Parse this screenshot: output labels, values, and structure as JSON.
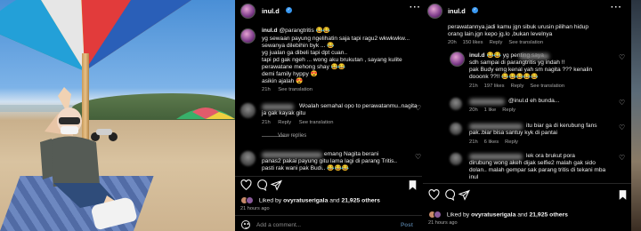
{
  "post": {
    "username": "inul.d",
    "likes_by": "ovyratuserigala",
    "likes_others": "21,925 others",
    "liked_by_prefix": "Liked by",
    "and_word": "and",
    "time_ago": "21 hours ago",
    "add_comment_placeholder": "Add a comment...",
    "post_label": "Post"
  },
  "comments_mid": [
    {
      "user": "inul.d",
      "lines": [
        "@parangtritis 😂😂",
        "yg sewaan payung ngelihatin saja tapi ragu2 wkwkwkw...",
        "sewanya dilebihin byk ... 😂",
        "yg jualan ga dibeli tapi dpt cuan..",
        "tapi pd gak ngeh ... wong aku brukutan , sayang kulite",
        "perawatane mehong shay 😂😂",
        "demi family hyppy 😍",
        "asikin ajalah 😍"
      ],
      "meta": [
        "21h",
        "See translation"
      ]
    },
    {
      "user": "",
      "lines": [
        "Woalah semahal opo to perawatanmu..nagita",
        "ja gak kayak gitu"
      ],
      "meta": [
        "21h",
        "Reply",
        "See translation"
      ]
    },
    {
      "user": "",
      "lines": [
        "emang Nagita berani",
        "panas2 pakai payung gitu lama lagi di parang Tritis..",
        "pasti rak wani pak Budi.. 😂😂😂"
      ],
      "meta": []
    }
  ],
  "view_replies": "View replies",
  "comments_right": [
    {
      "lines": [
        "perawatannya.jadi kamu jgn sibuk urusin pilihan hidup",
        "orang lain.jgn kepo jg.lo ,bukan levelnya"
      ],
      "meta": [
        "20h",
        "150 likes",
        "Reply",
        "See translation"
      ]
    },
    {
      "user": "inul.d",
      "lines": [
        "😂😂 yg penting saya",
        "sdh sampai di parangtritis yg indah !!",
        "pak Budy emg kenal yah sm nagita ??? kenalin",
        "dooonk ??!! 😂😂😂😂😂"
      ],
      "meta": [
        "21h",
        "197 likes",
        "Reply",
        "See translation"
      ]
    },
    {
      "lines": [
        "@inul.d eh bunda..."
      ],
      "meta": [
        "20h",
        "1 like",
        "Reply"
      ]
    },
    {
      "lines": [
        "itu biar ga di kerubung fans",
        "pak..biar bisa santuy kyk di pantai"
      ],
      "meta": [
        "21h",
        "6 likes",
        "Reply"
      ]
    },
    {
      "lines": [
        "lek ora brukut pora",
        "dirubung wong akeh dijak selfie2 malah gak sido",
        "dolan.. malah gempar sak parang tritis di tekani mba",
        "inul"
      ],
      "meta": []
    }
  ],
  "icons": [
    "heart-icon",
    "comment-icon",
    "share-icon",
    "bookmark-icon",
    "more-icon",
    "verified-icon",
    "smiley-icon"
  ],
  "colors": {
    "background": "#000000",
    "verified": "#3897f0",
    "muted": "#a8a8a8"
  }
}
